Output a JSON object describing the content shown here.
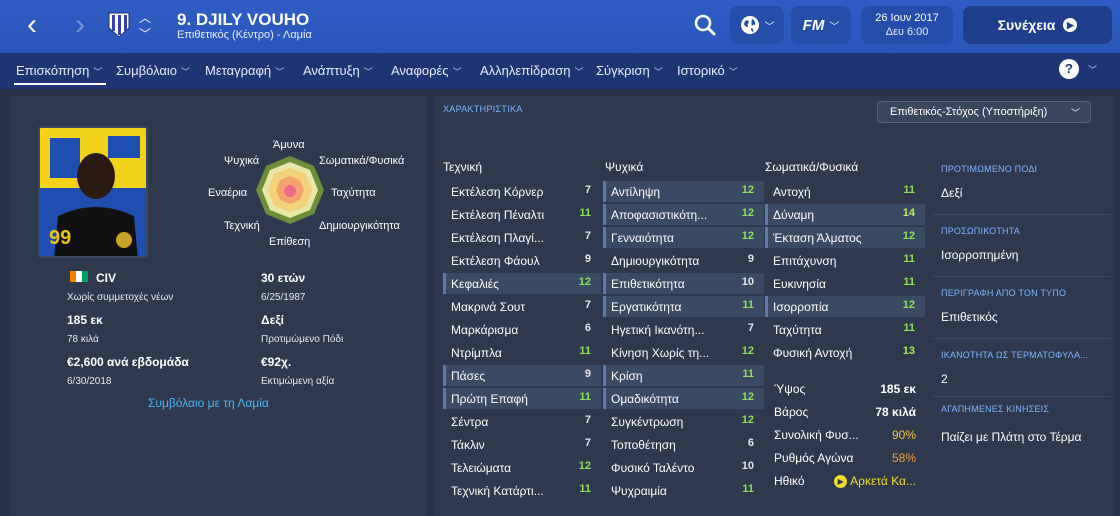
{
  "header": {
    "back_glyph": "‹",
    "forward_glyph": "›",
    "title": "9. DJILY VOUHO",
    "subtitle": "Επιθετικός (Κέντρο) - Λαμία",
    "date": "26 Ιουν 2017",
    "time": "Δευ 6:00",
    "fm_label": "FM",
    "continue_label": "Συνέχεια"
  },
  "nav": {
    "tabs": [
      {
        "label": "Επισκόπηση",
        "active": true
      },
      {
        "label": "Συμβόλαιο"
      },
      {
        "label": "Μεταγραφή"
      },
      {
        "label": "Ανάπτυξη"
      },
      {
        "label": "Αναφορές"
      },
      {
        "label": "Αλληλεπίδραση"
      },
      {
        "label": "Σύγκριση"
      },
      {
        "label": "Ιστορικό"
      }
    ],
    "help": "?"
  },
  "player": {
    "shirt_number": "99",
    "radar": {
      "top": "Άμυνα",
      "upper_left": "Ψυχικά",
      "upper_right": "Σωματικά/Φυσικά",
      "left": "Εναέρια",
      "right": "Ταχύτητα",
      "lower_left": "Τεχνική",
      "lower_right": "Δημιουργικότητα",
      "bottom": "Επίθεση"
    },
    "nationality": "CIV",
    "youth_caps": "Χωρίς συμμετοχές νέων",
    "age": "30 ετών",
    "dob": "6/25/1987",
    "height": "185 εκ",
    "weight": "78 κιλά",
    "foot": "Δεξί",
    "foot_label": "Προτιμώμενο Πόδι",
    "wage": "€2,600 ανά εβδομάδα",
    "contract_end": "6/30/2018",
    "value": "€92χ.",
    "value_label": "Εκτιμώμενη αξία",
    "contract_link": "Συμβόλαιο με τη Λαμία"
  },
  "attributes": {
    "title": "ΧΑΡΑΚΤΗΡΙΣΤΙΚΑ",
    "role": "Επιθετικός-Στόχος (Υποστήριξη)",
    "technical_header": "Τεχνική",
    "mental_header": "Ψυχικά",
    "physical_header": "Σωματικά/Φυσικά",
    "technical": [
      {
        "name": "Εκτέλεση Κόρνερ",
        "value": "7",
        "hl": false
      },
      {
        "name": "Εκτέλεση Πέναλτι",
        "value": "11",
        "hl": false
      },
      {
        "name": "Εκτέλεση Πλαγί...",
        "value": "7",
        "hl": false
      },
      {
        "name": "Εκτέλεση Φάουλ",
        "value": "9",
        "hl": false
      },
      {
        "name": "Κεφαλιές",
        "value": "12",
        "hl": true
      },
      {
        "name": "Μακρινά Σουτ",
        "value": "7",
        "hl": false
      },
      {
        "name": "Μαρκάρισμα",
        "value": "6",
        "hl": false
      },
      {
        "name": "Ντρίμπλα",
        "value": "11",
        "hl": false
      },
      {
        "name": "Πάσες",
        "value": "9",
        "hl": true
      },
      {
        "name": "Πρώτη Επαφή",
        "value": "11",
        "hl": true
      },
      {
        "name": "Σέντρα",
        "value": "7",
        "hl": false
      },
      {
        "name": "Τάκλιν",
        "value": "7",
        "hl": false
      },
      {
        "name": "Τελειώματα",
        "value": "12",
        "hl": false
      },
      {
        "name": "Τεχνική Κατάρτι...",
        "value": "11",
        "hl": false
      }
    ],
    "mental": [
      {
        "name": "Αντίληψη",
        "value": "12",
        "hl": true
      },
      {
        "name": "Αποφασιστικότη...",
        "value": "12",
        "hl": true
      },
      {
        "name": "Γενναιότητα",
        "value": "12",
        "hl": true
      },
      {
        "name": "Δημιουργικότητα",
        "value": "9",
        "hl": false
      },
      {
        "name": "Επιθετικότητα",
        "value": "10",
        "hl": true
      },
      {
        "name": "Εργατικότητα",
        "value": "11",
        "hl": true
      },
      {
        "name": "Ηγετική Ικανότη...",
        "value": "7",
        "hl": false
      },
      {
        "name": "Κίνηση Χωρίς τη...",
        "value": "12",
        "hl": false
      },
      {
        "name": "Κρίση",
        "value": "11",
        "hl": true
      },
      {
        "name": "Ομαδικότητα",
        "value": "12",
        "hl": true
      },
      {
        "name": "Συγκέντρωση",
        "value": "12",
        "hl": false
      },
      {
        "name": "Τοποθέτηση",
        "value": "6",
        "hl": false
      },
      {
        "name": "Φυσικό Ταλέντο",
        "value": "10",
        "hl": false
      },
      {
        "name": "Ψυχραιμία",
        "value": "11",
        "hl": false
      }
    ],
    "physical": [
      {
        "name": "Αντοχή",
        "value": "11",
        "hl": false
      },
      {
        "name": "Δύναμη",
        "value": "14",
        "hl": true
      },
      {
        "name": "Έκταση Άλματος",
        "value": "12",
        "hl": true
      },
      {
        "name": "Επιτάχυνση",
        "value": "11",
        "hl": false
      },
      {
        "name": "Ευκινησία",
        "value": "11",
        "hl": false
      },
      {
        "name": "Ισορροπία",
        "value": "12",
        "hl": true
      },
      {
        "name": "Ταχύτητα",
        "value": "11",
        "hl": false
      },
      {
        "name": "Φυσική Αντοχή",
        "value": "13",
        "hl": false
      }
    ],
    "bio": {
      "height_label": "Ύψος",
      "height": "185 εκ",
      "weight_label": "Βάρος",
      "weight": "78 κιλά",
      "fitness_label": "Συνολική Φυσ...",
      "fitness": "90%",
      "match_label": "Ρυθμός Αγώνα",
      "match": "58%",
      "morale_label": "Ηθικό",
      "morale": "Αρκετά Κα..."
    }
  },
  "side": {
    "foot_head": "ΠΡΟΤΙΜΩΜΕΝΟ ΠΟΔΙ",
    "foot": "Δεξί",
    "personality_head": "ΠΡΟΣΩΠΙΚΟΤΗΤΑ",
    "personality": "Ισορροπημένη",
    "type_head": "ΠΕΡΙΓΡΑΦΗ ΑΠΟ ΤΟΝ ΤΥΠΟ",
    "type": "Επιθετικός",
    "finishing_head": "ΙΚΑΝΟΤΗΤΑ ΩΣ ΤΕΡΜΑΤΟΦΥΛΑ...",
    "finishing": "2",
    "moves_head": "ΑΓΑΠΗΜΕΝΕΣ ΚΙΝΗΣΕΙΣ",
    "moves": "Παίζει με Πλάτη στο Τέρμα"
  },
  "colors": {
    "header_blue": "#2f5dc4",
    "nav_blue": "#1f3573",
    "panel_bg": "#2e394e",
    "attr_green": "#8ee05a",
    "fitness_orange": "#f39c32",
    "morale_yellow": "#f3dd2a",
    "link_blue": "#4fb3f3"
  }
}
